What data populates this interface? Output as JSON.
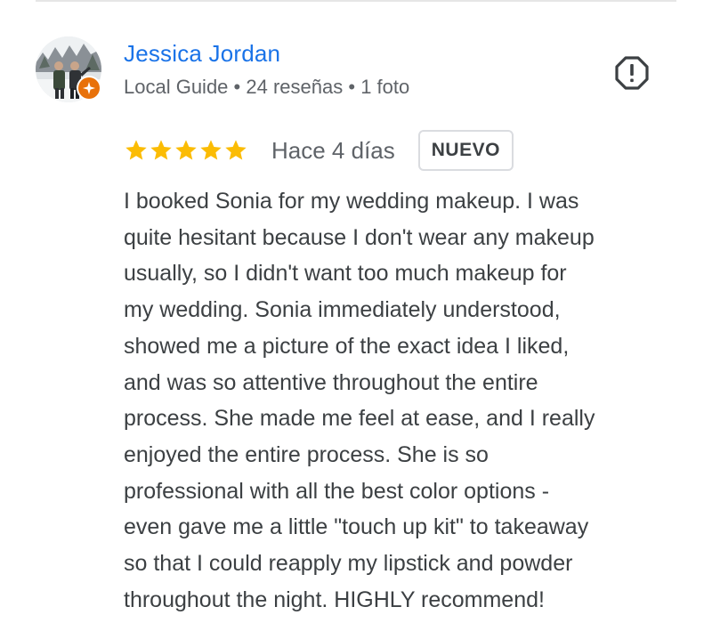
{
  "reviewer": {
    "name": "Jessica Jordan",
    "level": "Local Guide",
    "reviews_count": "24 reseñas",
    "photos_count": "1 foto",
    "separator": "•"
  },
  "review": {
    "rating": 5,
    "rating_max": 5,
    "date": "Hace 4 días",
    "badge": "NUEVO",
    "text_lines": [
      "I booked Sonia for my wedding makeup. I was",
      "quite hesitant because I don't wear any makeup",
      "usually, so I didn't want too much makeup for",
      "my wedding. Sonia immediately understood,",
      "showed me a picture of the exact idea I liked,",
      "and was so attentive throughout the entire",
      "process. She made me feel at ease, and I really",
      "enjoyed the entire process. She is so",
      "professional with all the best color options -",
      "even gave me a little \"touch up kit\" to takeaway",
      "so that I could reapply my lipstick and powder",
      "throughout the night. HIGHLY recommend!"
    ]
  },
  "icons": {
    "avatar": "reviewer-avatar-photo",
    "guide_badge": "local-guide-star-icon",
    "report": "report-flag-icon",
    "star": "star-icon"
  },
  "colors": {
    "name": "#1a73e8",
    "meta": "#5f6368",
    "body_text": "#3c4043",
    "star": "#fbbc04",
    "guide_badge": "#e8710a"
  }
}
